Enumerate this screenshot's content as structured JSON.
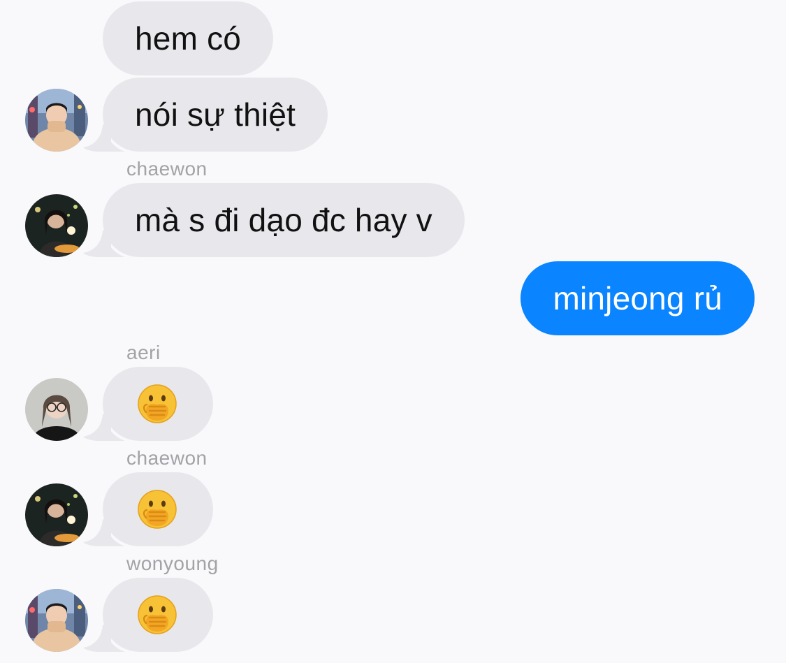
{
  "colors": {
    "background": "#f9f9fb",
    "incoming_bubble": "#e8e7ec",
    "outgoing_bubble": "#0a84ff",
    "sender_name": "#a2a2a7"
  },
  "messages": [
    {
      "direction": "incoming",
      "text": "hem có"
    },
    {
      "direction": "incoming",
      "text": "nói sự thiệt",
      "avatar": "person-avatar-wonyoung"
    },
    {
      "direction": "incoming",
      "sender": "chaewon",
      "text": "mà s đi dạo đc hay v",
      "avatar": "person-avatar-chaewon"
    },
    {
      "direction": "outgoing",
      "text": "minjeong rủ"
    },
    {
      "direction": "incoming",
      "sender": "aeri",
      "emoji": "face-with-hand-over-mouth",
      "avatar": "person-avatar-aeri"
    },
    {
      "direction": "incoming",
      "sender": "chaewon",
      "emoji": "face-with-hand-over-mouth",
      "avatar": "person-avatar-chaewon"
    },
    {
      "direction": "incoming",
      "sender": "wonyoung",
      "emoji": "face-with-hand-over-mouth",
      "avatar": "person-avatar-wonyoung"
    }
  ]
}
